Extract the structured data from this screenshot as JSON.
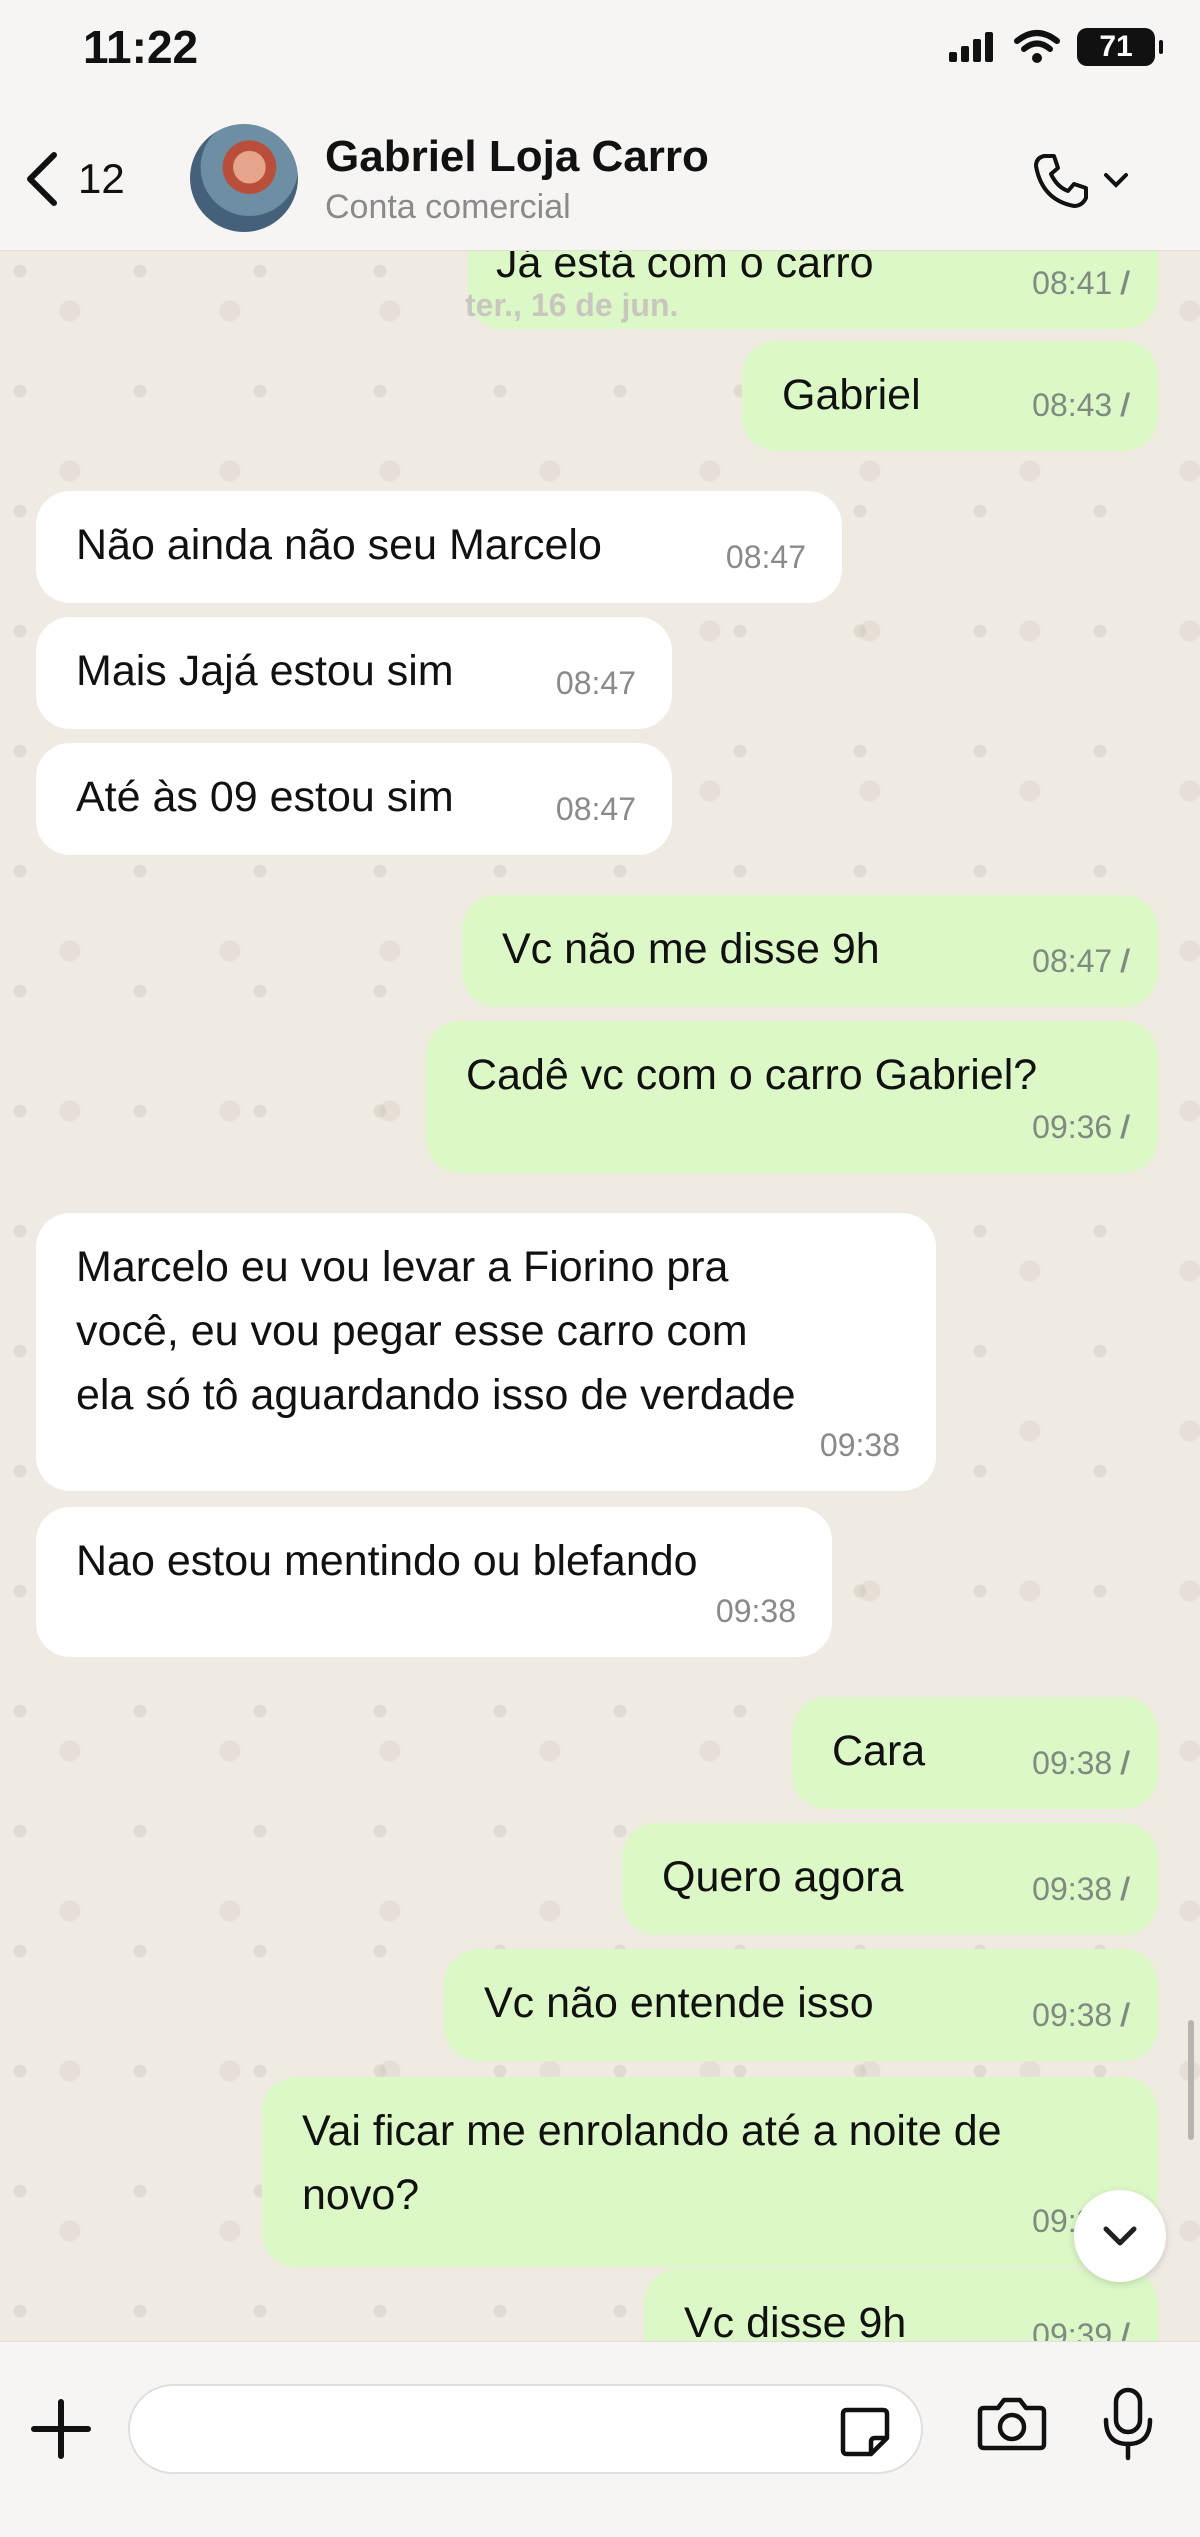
{
  "status": {
    "time": "11:22",
    "battery": "71"
  },
  "header": {
    "back_count": "12",
    "name": "Gabriel Loja Carro",
    "subtitle": "Conta comercial"
  },
  "date_label": "ter., 16 de jun.",
  "messages": [
    {
      "dir": "out",
      "text": "Já está com o carro",
      "time": "08:41",
      "ticks": "//"
    },
    {
      "dir": "out",
      "text": "Gabriel",
      "time": "08:43",
      "ticks": "//"
    },
    {
      "dir": "in",
      "text": "Não ainda não seu Marcelo",
      "time": "08:47"
    },
    {
      "dir": "in",
      "text": "Mais Jajá estou sim",
      "time": "08:47"
    },
    {
      "dir": "in",
      "text": "Até às 09 estou sim",
      "time": "08:47"
    },
    {
      "dir": "out",
      "text": "Vc não me disse 9h",
      "time": "08:47",
      "ticks": "//"
    },
    {
      "dir": "out",
      "text": "Cadê vc com o carro Gabriel?",
      "time": "09:36",
      "ticks": "//"
    },
    {
      "dir": "in",
      "text": "Marcelo eu vou levar a Fiorino pra\nvocê, eu vou pegar esse carro com\nela só tô aguardando isso de verdade",
      "time": "09:38"
    },
    {
      "dir": "in",
      "text": "Nao estou mentindo ou blefando",
      "time": "09:38"
    },
    {
      "dir": "out",
      "text": "Cara",
      "time": "09:38",
      "ticks": "//"
    },
    {
      "dir": "out",
      "text": "Quero agora",
      "time": "09:38",
      "ticks": "//"
    },
    {
      "dir": "out",
      "text": "Vc não entende isso",
      "time": "09:38",
      "ticks": "//"
    },
    {
      "dir": "out",
      "text": "Vai ficar me enrolando até a noite de\nnovo?",
      "time": "09:38",
      "ticks": "//"
    },
    {
      "dir": "out",
      "text": "Vc disse 9h",
      "time": "09:39",
      "ticks": "//"
    }
  ]
}
